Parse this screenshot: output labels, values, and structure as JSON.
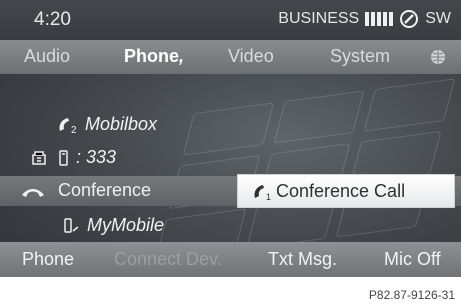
{
  "status": {
    "time": "4:20",
    "profile": "BUSINESS",
    "direction": "SW",
    "signal_bars": 5
  },
  "top_menu": {
    "items": [
      {
        "label": "Audio",
        "active": false
      },
      {
        "label": "Phone",
        "active": true
      },
      {
        "label": "Video",
        "active": false
      },
      {
        "label": "System",
        "active": false
      }
    ],
    "globe_icon": "globe-icon"
  },
  "contacts": {
    "mobilbox": {
      "label": "Mobilbox",
      "icon": "handset-2-icon"
    },
    "number": {
      "label": ": 333",
      "icon": "phone-device-icon"
    },
    "conference": {
      "label": "Conference",
      "icon": "hangup-icon"
    },
    "mymobile": {
      "label": "MyMobile",
      "icon": "mobile-icon"
    }
  },
  "conference_call": {
    "label": "Conference Call",
    "icon": "handset-1-icon"
  },
  "bottom_bar": {
    "items": [
      {
        "label": "Phone",
        "enabled": true
      },
      {
        "label": "Connect Dev.",
        "enabled": false
      },
      {
        "label": "Txt Msg.",
        "enabled": true
      },
      {
        "label": "Mic Off",
        "enabled": true
      }
    ]
  },
  "caption": "P82.87-9126-31"
}
